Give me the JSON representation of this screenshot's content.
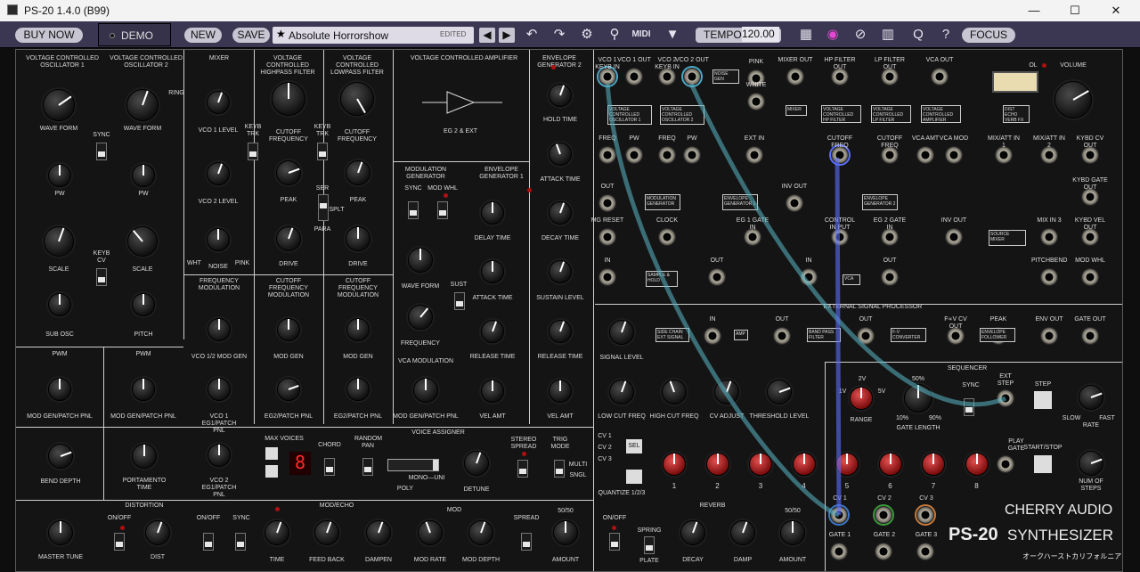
{
  "window": {
    "title": "PS-20 1.4.0 (B99)",
    "min": "—",
    "max": "☐",
    "close": "✕"
  },
  "toolbar": {
    "buy_now": "BUY NOW",
    "demo": "DEMO",
    "new": "NEW",
    "save": "SAVE",
    "preset_name": "Absolute Horrorshow",
    "preset_status": "EDITED",
    "tempo_label": "TEMPO",
    "tempo_value": "120.00",
    "focus": "FOCUS",
    "midi": "MIDI"
  },
  "colors": {
    "toolbar": "#3b3752",
    "panel": "#141414",
    "cable_teal": "#59b6c6",
    "cable_blue": "#5c6fff",
    "red_knob": "#c01818"
  },
  "panel": {
    "vco1_title": "VOLTAGE CONTROLLED OSCILLATOR  1",
    "vco2_title": "VOLTAGE CONTROLLED OSCILLATOR  2",
    "mixer_title": "MIXER",
    "hpf_title": "VOLTAGE CONTROLLED HIGHPASS FILTER",
    "lpf_title": "VOLTAGE CONTROLLED LOWPASS FILTER",
    "vca_title": "VOLTAGE CONTROLLED AMPLIFIER",
    "eg2_title": "ENVELOPE GENERATOR 2",
    "eg2_ext": "EG 2 & EXT",
    "modgen_title": "MODULATION GENERATOR",
    "eg1_title": "ENVELOPE GENERATOR 1",
    "wave_form": "WAVE FORM",
    "pw": "PW",
    "scale": "SCALE",
    "sub_osc": "SUB OSC",
    "pitch": "PITCH",
    "sync": "SYNC",
    "keyb_cv": "KEYB CV",
    "ring": "RING",
    "vco1_level": "VCO 1 LEVEL",
    "vco2_level": "VCO 2 LEVEL",
    "noise": "NOISE",
    "wht": "WHT",
    "pink": "PINK",
    "cutoff_frequency": "CUTOFF FREQUENCY",
    "keyb_trk": "KEYB TRK",
    "peak": "PEAK",
    "drive": "DRIVE",
    "ser": "SER",
    "splt": "SPLT",
    "para": "PARA",
    "hold_time": "HOLD TIME",
    "attack_time": "ATTACK TIME",
    "decay_time": "DECAY TIME",
    "sustain_level": "SUSTAIN LEVEL",
    "release_time": "RELEASE TIME",
    "vel_amt": "VEL AMT",
    "mod_whl": "MOD WHL",
    "wave_form_mg": "WAVE FORM",
    "sust": "SUST",
    "frequency": "FREQUENCY",
    "delay_time": "DELAY TIME",
    "freq_mod": "FREQUENCY MODULATION",
    "cutoff_freq_mod": "CUTOFF FREQUENCY MODULATION",
    "vco12_modgen": "VCO 1/2 MOD GEN",
    "mod_gen": "MOD GEN",
    "vco1_eg1": "VCO 1 EG1/PATCH PNL",
    "eg2_patch": "EG2/PATCH PNL",
    "vca_mod": "VCA MODULATION",
    "modgen_patch": "MOD GEN/PATCH PNL",
    "pwm": "PWM",
    "bend_depth": "BEND DEPTH",
    "portamento": "PORTAMENTO TIME",
    "vco2_eg1": "VCO 2 EG1/PATCH PNL",
    "voice_assigner": "VOICE ASSIGNER",
    "max_voices": "MAX VOICES",
    "voices_value": "8",
    "chord": "CHORD",
    "random_pan": "RANDOM PAN",
    "stereo_spread": "STEREO SPREAD",
    "trig_mode": "TRIG MODE",
    "multi": "MULTI",
    "sngl": "SNGL",
    "poly": "POLY",
    "mono_uni": "MONO—UNI",
    "detune": "DETUNE",
    "cv1": "CV 1",
    "cv2": "CV 2",
    "cv3": "CV 3",
    "sel": "SEL",
    "quantize": "QUANTIZE 1/2/3",
    "sequencer": "SEQUENCER",
    "range": "RANGE",
    "gate_length": "GATE LENGTH",
    "rate": "RATE",
    "slow": "SLOW",
    "fast": "FAST",
    "ext_step": "EXT STEP",
    "step": "STEP",
    "play_gate": "PLAY GATE",
    "start_stop": "START/STOP",
    "num_steps": "NUM OF STEPS",
    "distortion": "DISTORTION",
    "on_off": "ON/OFF",
    "dist": "DIST",
    "mod_echo": "MOD/ECHO",
    "time": "TIME",
    "feed_back": "FEED BACK",
    "dampen": "DAMPEN",
    "mod": "MOD",
    "mod_rate": "MOD RATE",
    "mod_depth": "MOD DEPTH",
    "spread": "SPREAD",
    "fifty": "50/50",
    "amount": "AMOUNT",
    "reverb": "REVERB",
    "spring": "SPRING",
    "plate": "PLATE",
    "decay": "DECAY",
    "damp": "DAMP",
    "master_tune": "MASTER TUNE",
    "ext_sig_proc": "EXTERNAL SIGNAL PROCESSOR",
    "volume": "VOLUME",
    "ol": "OL",
    "brand": "CHERRY AUDIO",
    "model": "PS-20",
    "synth": "SYNTHESIZER",
    "jp": "オークハーストカリフォルニア",
    "signal_level": "SIGNAL LEVEL",
    "low_cut": "LOW CUT FREQ",
    "high_cut": "HIGH CUT FREQ",
    "cv_adjust": "CV ADJUST",
    "threshold": "THRESHOLD LEVEL"
  },
  "jacks": [
    "VCO 1 KEYB IN",
    "VCO 1 OUT",
    "VCO 2 KEYB IN",
    "VCO 2 OUT",
    "PINK",
    "WHITE",
    "MIXER OUT",
    "HP FILTER OUT",
    "LP FILTER OUT",
    "VCA OUT",
    "FREQ",
    "PW",
    "FREQ",
    "PW",
    "EXT IN",
    "CUTOFF FREQ",
    "CUTOFF FREQ",
    "VCA AMT",
    "VCA MOD",
    "OUT",
    "MG RESET",
    "CLOCK",
    "EG 1 GATE IN",
    "INV OUT",
    "CONTROL IN PUT",
    "EG 2 GATE IN",
    "INV OUT",
    "IN",
    "OUT",
    "IN",
    "OUT",
    "MIX/ATT IN 1",
    "MIX/ATT IN 2",
    "KYBD CV OUT",
    "KYBD GATE OUT",
    "KYBD VEL OUT",
    "MIX IN 3",
    "PITCHBEND",
    "MOD WHL",
    "IN",
    "OUT",
    "OUT",
    "F∝V CV OUT",
    "PEAK",
    "ENV OUT",
    "GATE OUT",
    "CV 1",
    "CV 2",
    "CV 3",
    "GATE 1",
    "GATE 2",
    "GATE 3"
  ],
  "seq_steps": [
    "1",
    "2",
    "3",
    "4",
    "5",
    "6",
    "7",
    "8"
  ],
  "volts": [
    "1V",
    "2V",
    "5V"
  ],
  "pcts": [
    "50%",
    "10%",
    "90%"
  ]
}
